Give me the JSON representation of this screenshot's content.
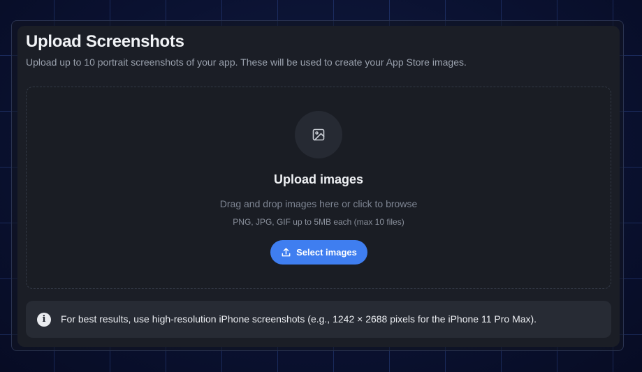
{
  "card": {
    "title": "Upload Screenshots",
    "subtitle": "Upload up to 10 portrait screenshots of your app. These will be used to create your App Store images."
  },
  "dropzone": {
    "icon": "image-icon",
    "heading": "Upload images",
    "hint": "Drag and drop images here or click to browse",
    "formats": "PNG, JPG, GIF up to 5MB each (max 10 files)",
    "button_icon": "upload-icon",
    "button_label": "Select images"
  },
  "info": {
    "icon": "info-icon",
    "icon_glyph": "i",
    "text": "For best results, use high-resolution iPhone screenshots (e.g., 1242 × 2688 pixels for the iPhone 11 Pro Max)."
  },
  "colors": {
    "accent": "#3f7ef0",
    "card_background": "#1b1e26",
    "page_background": "#0b1230"
  }
}
